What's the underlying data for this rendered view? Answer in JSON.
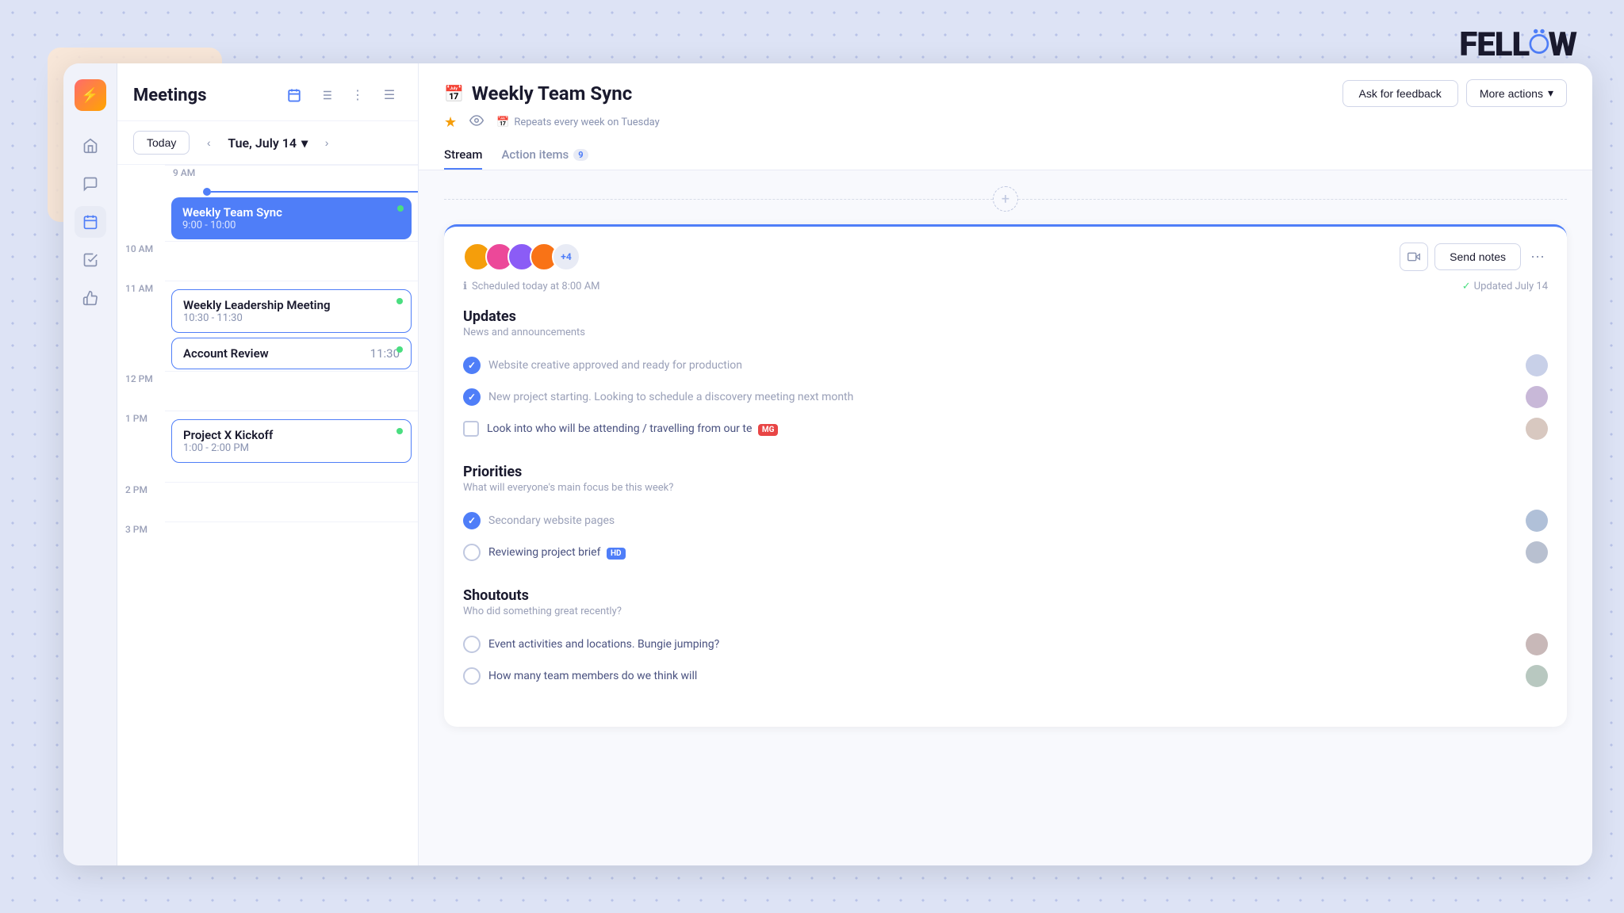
{
  "app": {
    "logo": "FELL☍W"
  },
  "sidebar": {
    "items": [
      {
        "id": "home",
        "icon": "⌂",
        "label": "Home"
      },
      {
        "id": "messages",
        "icon": "≡",
        "label": "Messages"
      },
      {
        "id": "calendar",
        "icon": "📅",
        "label": "Calendar",
        "active": true
      },
      {
        "id": "tasks",
        "icon": "☑",
        "label": "Tasks"
      },
      {
        "id": "feedback",
        "icon": "👍",
        "label": "Feedback"
      }
    ]
  },
  "meetings": {
    "title": "Meetings",
    "date": {
      "today_label": "Today",
      "current": "Tue, July 14"
    },
    "events": [
      {
        "id": "weekly-team-sync",
        "title": "Weekly Team Sync",
        "time": "9:00 - 10:00",
        "time_slot": "9 AM",
        "style": "blue",
        "dot": "green"
      },
      {
        "id": "weekly-leadership",
        "title": "Weekly Leadership Meeting",
        "time": "10:30 - 11:30",
        "time_slot": "11 AM",
        "style": "outline",
        "dot": "green"
      },
      {
        "id": "account-review",
        "title": "Account Review",
        "time": "11:30",
        "time_slot": "11 AM",
        "style": "outline",
        "dot": "green"
      },
      {
        "id": "project-x",
        "title": "Project X Kickoff",
        "time": "1:00 - 2:00 PM",
        "time_slot": "1 PM",
        "style": "outline",
        "dot": "green"
      }
    ],
    "time_slots": [
      "9 AM",
      "10 AM",
      "11 AM",
      "12 PM",
      "1 PM",
      "2 PM",
      "3 PM"
    ]
  },
  "meeting_detail": {
    "title": "Weekly Team Sync",
    "repeat_info": "Repeats every week on Tuesday",
    "tabs": [
      {
        "id": "stream",
        "label": "Stream",
        "active": true
      },
      {
        "id": "action-items",
        "label": "Action items",
        "badge": "9"
      }
    ],
    "actions": {
      "ask_feedback": "Ask for feedback",
      "more_actions": "More actions"
    },
    "session": {
      "attendee_count": "+4",
      "scheduled": "Scheduled today at 8:00 AM",
      "updated": "Updated July 14",
      "send_notes": "Send notes"
    },
    "sections": [
      {
        "id": "updates",
        "title": "Updates",
        "subtitle": "News and announcements",
        "items": [
          {
            "id": "item1",
            "text": "Website creative approved and ready for production",
            "checked": true,
            "type": "circle",
            "avatar_color": "#b8c2e0"
          },
          {
            "id": "item2",
            "text": "New project starting. Looking to schedule a discovery meeting next month",
            "checked": true,
            "type": "circle",
            "avatar_color": "#c0a8d0"
          },
          {
            "id": "item3",
            "text": "Look into who will be attending / travelling from our te",
            "checked": false,
            "type": "square",
            "badge": "MG",
            "badge_color": "red",
            "avatar_color": "#d0c8c0"
          }
        ]
      },
      {
        "id": "priorities",
        "title": "Priorities",
        "subtitle": "What will everyone's main focus be this week?",
        "items": [
          {
            "id": "pitem1",
            "text": "Secondary website pages",
            "checked": true,
            "type": "circle",
            "avatar_color": "#b8c8e0"
          },
          {
            "id": "pitem2",
            "text": "Reviewing project brief",
            "checked": false,
            "type": "circle-empty",
            "badge": "HD",
            "badge_color": "blue",
            "avatar_color": "#b8c2d8"
          }
        ]
      },
      {
        "id": "shoutouts",
        "title": "Shoutouts",
        "subtitle": "Who did something great recently?",
        "items": [
          {
            "id": "sitem1",
            "text": "Event activities and locations. Bungie jumping?",
            "checked": false,
            "type": "circle-empty",
            "avatar_color": "#c8b8b8"
          },
          {
            "id": "sitem2",
            "text": "How many team members do we think will",
            "checked": false,
            "type": "circle-empty",
            "avatar_color": "#b8c8c0"
          }
        ]
      }
    ]
  }
}
